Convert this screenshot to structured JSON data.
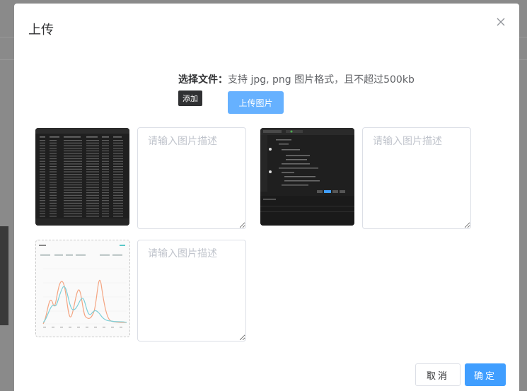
{
  "dialog": {
    "title": "上传",
    "close_icon": "close-icon"
  },
  "upload": {
    "file_label": "选择文件：",
    "hint": "支持 jpg, png 图片格式，且不超过500kb",
    "tooltip": "添加",
    "button_label": "上传图片"
  },
  "images": [
    {
      "kind": "screenshot-table",
      "description": "",
      "placeholder": "请输入图片描述"
    },
    {
      "kind": "screenshot-code",
      "description": "",
      "placeholder": "请输入图片描述"
    },
    {
      "kind": "screenshot-chart",
      "description": "",
      "placeholder": "请输入图片描述"
    }
  ],
  "footer": {
    "cancel_label": "取消",
    "confirm_label": "确定"
  },
  "colors": {
    "primary": "#409eff",
    "primary_light": "#66b1ff"
  }
}
